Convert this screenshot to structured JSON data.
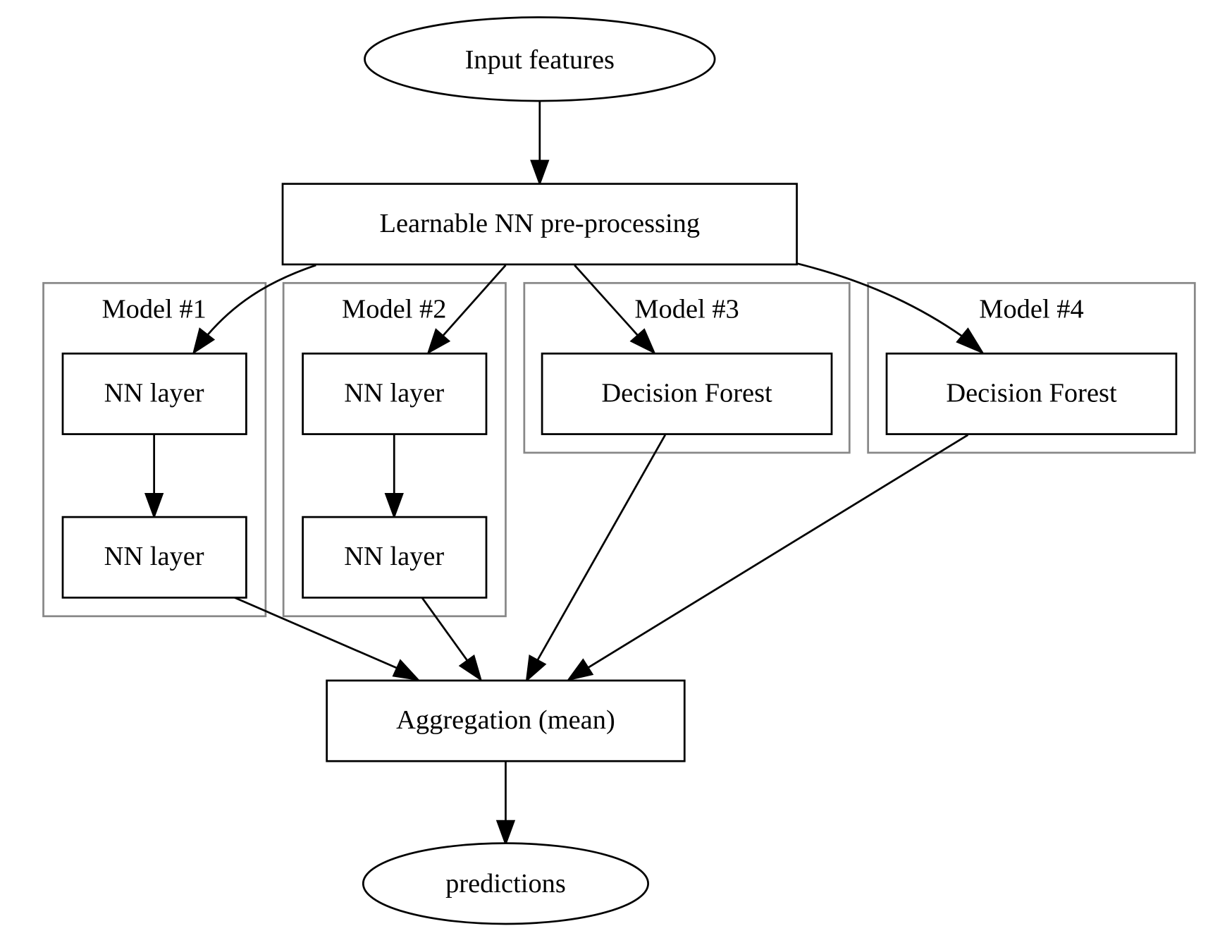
{
  "diagram": {
    "nodes": {
      "input": "Input features",
      "preprocess": "Learnable NN pre-processing",
      "m1_layer1": "NN layer",
      "m1_layer2": "NN layer",
      "m2_layer1": "NN layer",
      "m2_layer2": "NN layer",
      "m3_forest": "Decision Forest",
      "m4_forest": "Decision Forest",
      "aggregation": "Aggregation (mean)",
      "predictions": "predictions"
    },
    "clusters": {
      "model1": "Model #1",
      "model2": "Model #2",
      "model3": "Model #3",
      "model4": "Model #4"
    },
    "edges": [
      [
        "input",
        "preprocess"
      ],
      [
        "preprocess",
        "m1_layer1"
      ],
      [
        "preprocess",
        "m2_layer1"
      ],
      [
        "preprocess",
        "m3_forest"
      ],
      [
        "preprocess",
        "m4_forest"
      ],
      [
        "m1_layer1",
        "m1_layer2"
      ],
      [
        "m2_layer1",
        "m2_layer2"
      ],
      [
        "m1_layer2",
        "aggregation"
      ],
      [
        "m2_layer2",
        "aggregation"
      ],
      [
        "m3_forest",
        "aggregation"
      ],
      [
        "m4_forest",
        "aggregation"
      ],
      [
        "aggregation",
        "predictions"
      ]
    ]
  }
}
